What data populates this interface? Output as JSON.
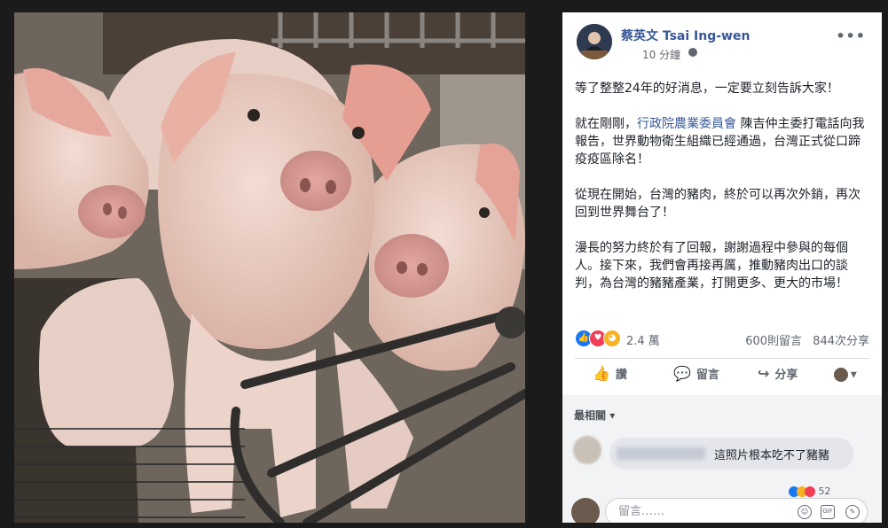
{
  "post": {
    "author": "蔡英文 Tsai Ing-wen",
    "time": "10 分鐘",
    "paragraphs": [
      "等了整整24年的好消息，一定要立刻告訴大家！",
      "從現在開始，台灣的豬肉，終於可以再次外銷，再次回到世界舞台了！",
      "漫長的努力終於有了回報，謝謝過程中參與的每個人。接下來，我們會再接再厲，推動豬肉出口的談判，為台灣的豬豬產業，打開更多、更大的市場！"
    ],
    "p2_prefix": "就在剛剛，",
    "p2_link": "行政院農業委員會",
    "p2_suffix": " 陳吉仲主委打電話向我報告，世界動物衛生組織已經通過，台灣正式從口蹄疫疫區除名！"
  },
  "reactions": {
    "count": "2.4 萬",
    "comments": "600則留言",
    "shares": "844次分享"
  },
  "actions": {
    "like": "讚",
    "comment": "留言",
    "share": "分享"
  },
  "comments": {
    "sort_label": "最相關",
    "items": [
      {
        "text": "這照片根本吃不了豬豬",
        "reaction_count": "52"
      }
    ]
  },
  "composer": {
    "placeholder": "留言……"
  },
  "icons": [
    "globe-icon",
    "more-icon",
    "like-icon",
    "heart-icon",
    "wow-icon",
    "comment-icon",
    "share-icon",
    "emoji-icon",
    "gif-icon",
    "sticker-icon"
  ],
  "colors": {
    "link": "#385898",
    "like_blue": "#1877f2",
    "heart_red": "#f33e58",
    "wow_yellow": "#f7b125"
  }
}
